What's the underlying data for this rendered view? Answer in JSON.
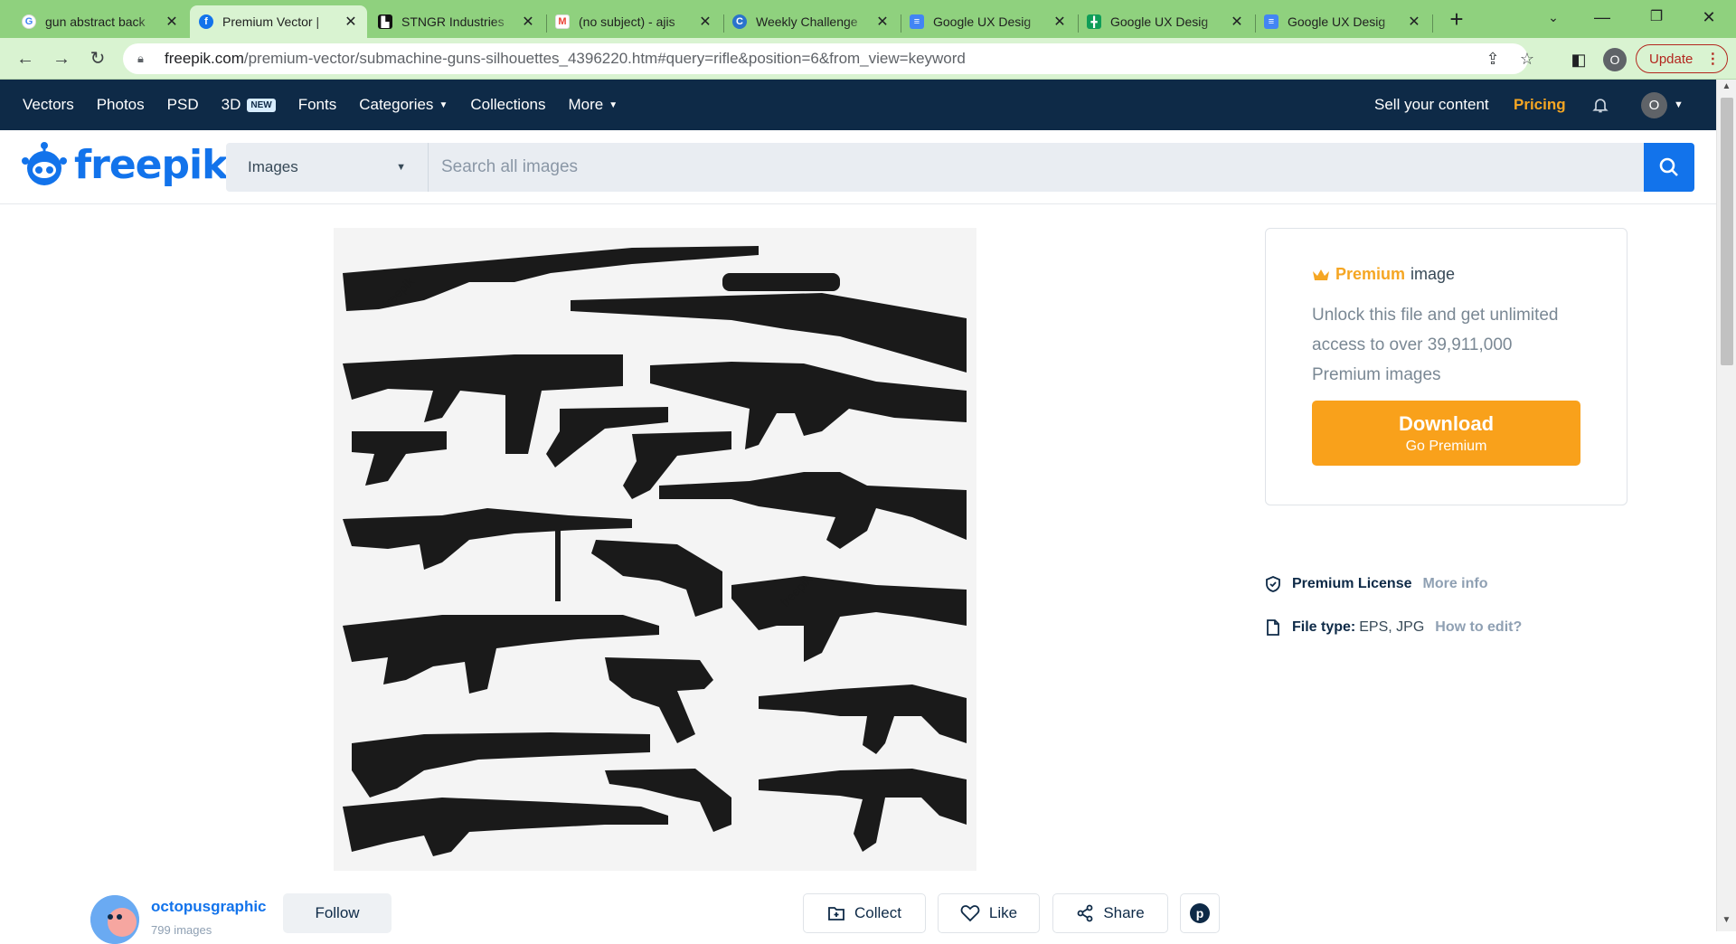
{
  "browser": {
    "tabs": [
      {
        "title": "gun abstract back",
        "favicon": "google-g-icon",
        "color": "#4285f4",
        "active": false
      },
      {
        "title": "Premium Vector |",
        "favicon": "freepik-icon",
        "color": "#1273eb",
        "active": true
      },
      {
        "title": "STNGR Industries",
        "favicon": "stngr-icon",
        "color": "#111111",
        "active": false
      },
      {
        "title": "(no subject) - ajis",
        "favicon": "gmail-icon",
        "color": "#ea4335",
        "active": false
      },
      {
        "title": "Weekly Challenge",
        "favicon": "coursera-icon",
        "color": "#2a73cc",
        "active": false
      },
      {
        "title": "Google UX Desig",
        "favicon": "docs-icon",
        "color": "#4285f4",
        "active": false
      },
      {
        "title": "Google UX Desig",
        "favicon": "sheets-icon",
        "color": "#0f9d58",
        "active": false
      },
      {
        "title": "Google UX Desig",
        "favicon": "docs-icon",
        "color": "#4285f4",
        "active": false
      }
    ],
    "url_host": "freepik.com",
    "url_rest": "/premium-vector/submachine-guns-silhouettes_4396220.htm#query=rifle&position=6&from_view=keyword",
    "profile_initial": "O",
    "update_label": "Update"
  },
  "nav": {
    "items": [
      {
        "label": "Vectors"
      },
      {
        "label": "Photos"
      },
      {
        "label": "PSD"
      },
      {
        "label": "3D",
        "badge": "NEW"
      },
      {
        "label": "Fonts"
      },
      {
        "label": "Categories",
        "dropdown": true
      },
      {
        "label": "Collections"
      },
      {
        "label": "More",
        "dropdown": true
      }
    ],
    "sell": "Sell your content",
    "pricing": "Pricing",
    "user_initial": "O"
  },
  "brand": {
    "logo_text": "freepik",
    "color": "#1273eb"
  },
  "search": {
    "type": "Images",
    "placeholder": "Search all images"
  },
  "premium": {
    "title_keyword": "Premium",
    "title_rest": "image",
    "description": "Unlock this file and get unlimited access to over 39,911,000 Premium images",
    "download_label": "Download",
    "download_sub": "Go Premium",
    "accent": "#f9a11b"
  },
  "meta": {
    "license_label": "Premium License",
    "license_link": "More info",
    "filetype_label": "File type:",
    "filetype_value": "EPS, JPG",
    "filetype_link": "How to edit?"
  },
  "author": {
    "name": "octopusgraphic",
    "count": "799 images",
    "follow_label": "Follow"
  },
  "actions": {
    "collect": "Collect",
    "like": "Like",
    "share": "Share"
  }
}
